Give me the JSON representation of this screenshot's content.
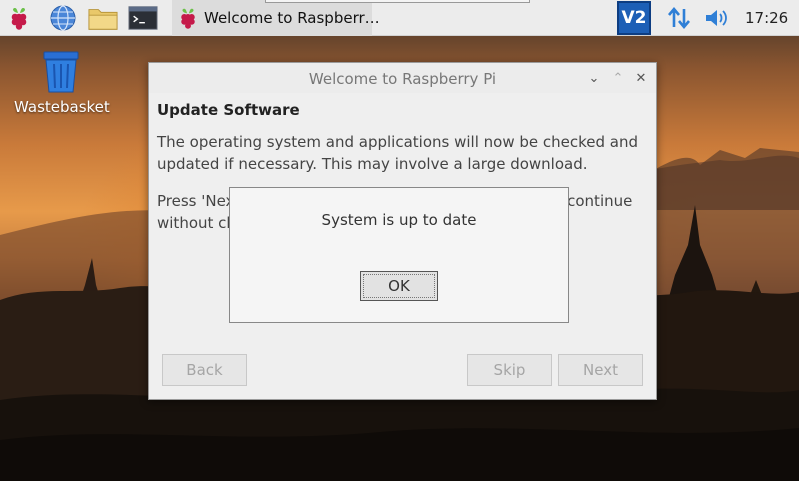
{
  "taskbar": {
    "launchers": [
      {
        "name": "raspberry-menu-icon"
      },
      {
        "name": "web-browser-icon"
      },
      {
        "name": "file-manager-icon"
      },
      {
        "name": "terminal-icon"
      }
    ],
    "task": {
      "label": "Welcome to Raspberr…",
      "icon": "raspberry-icon"
    },
    "tray": {
      "vnc_label": "V2",
      "network": "network-updown-icon",
      "volume": "volume-icon"
    },
    "clock": "17:26"
  },
  "desktop": {
    "items": [
      {
        "label": "Wastebasket",
        "icon": "wastebasket-icon"
      }
    ]
  },
  "window": {
    "title": "Welcome to Raspberry Pi",
    "controls": {
      "minimize": "⌄",
      "maximize": "⌃",
      "close": "✕"
    },
    "section_title": "Update Software",
    "paragraph1": "The operating system and applications will now be checked and updated if necessary. This may involve a large download.",
    "paragraph2": "Press 'Next' to check and update software, or 'Skip' to continue without checking.",
    "buttons": {
      "back": "Back",
      "skip": "Skip",
      "next": "Next"
    }
  },
  "dialog": {
    "message": "System is up to date",
    "ok": "OK"
  },
  "colors": {
    "taskbar_bg": "#ececec",
    "vnc_blue": "#1d5fb6",
    "raspberry_red": "#c51a4a",
    "leaf_green": "#6cc04a"
  }
}
